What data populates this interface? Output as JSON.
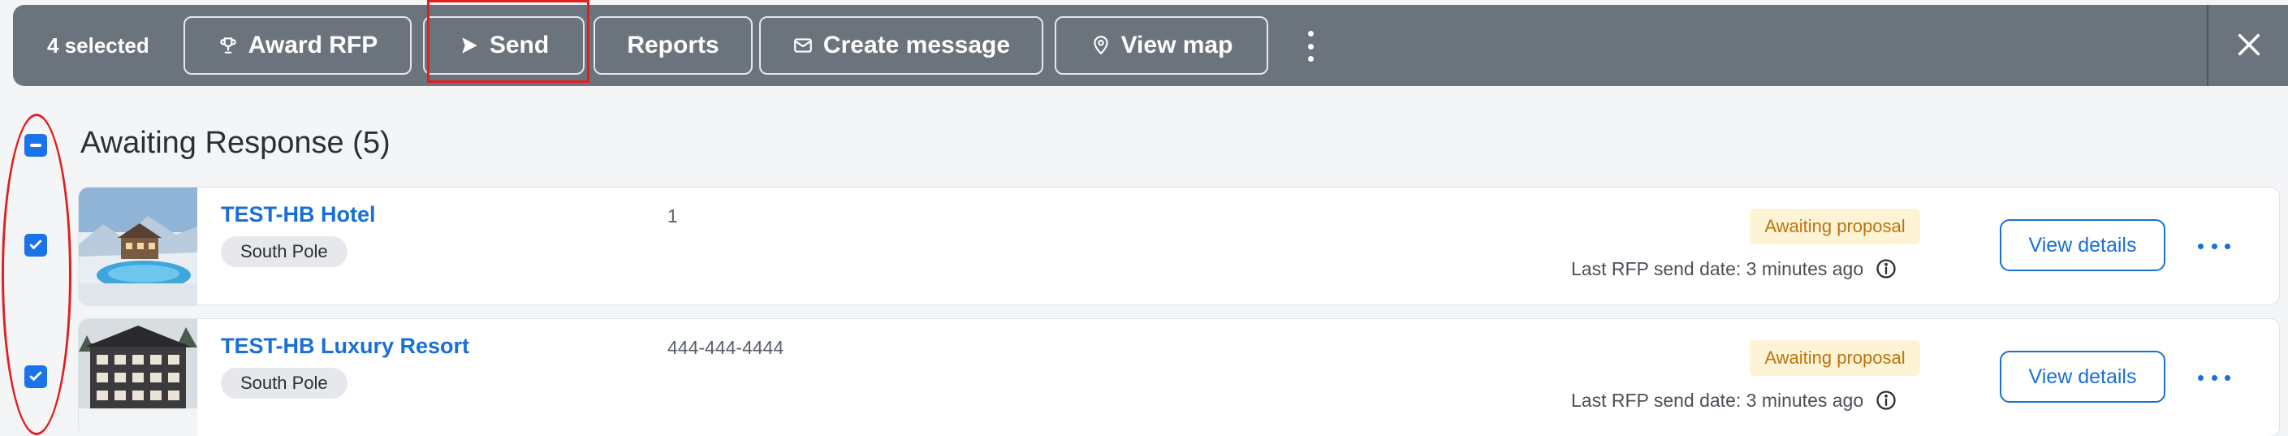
{
  "toolbar": {
    "selected_label": "4 selected",
    "buttons": [
      {
        "label": "Award RFP",
        "icon": "trophy-icon"
      },
      {
        "label": "Send",
        "icon": "send-icon"
      },
      {
        "label": "Reports"
      },
      {
        "label": "Create message",
        "icon": "mail-icon"
      },
      {
        "label": "View map",
        "icon": "map-pin-icon"
      }
    ],
    "more_icon": "kebab-vertical-icon",
    "close_icon": "close-icon"
  },
  "section": {
    "title": "Awaiting Response (5)"
  },
  "rows": [
    {
      "name": "TEST-HB Hotel",
      "location": "South Pole",
      "phone": "1",
      "status": "Awaiting proposal",
      "last_send": "Last RFP send date: 3 minutes ago",
      "action": "View details",
      "checked": true
    },
    {
      "name": "TEST-HB Luxury Resort",
      "location": "South Pole",
      "phone": "444-444-4444",
      "status": "Awaiting proposal",
      "last_send": "Last RFP send date: 3 minutes ago",
      "action": "View details",
      "checked": true
    }
  ],
  "colors": {
    "toolbar_bg": "#6b737d",
    "accent": "#1a6fd6",
    "status_text": "#c0720c",
    "status_bg": "#fdf4d6",
    "annotation": "#e02020"
  }
}
